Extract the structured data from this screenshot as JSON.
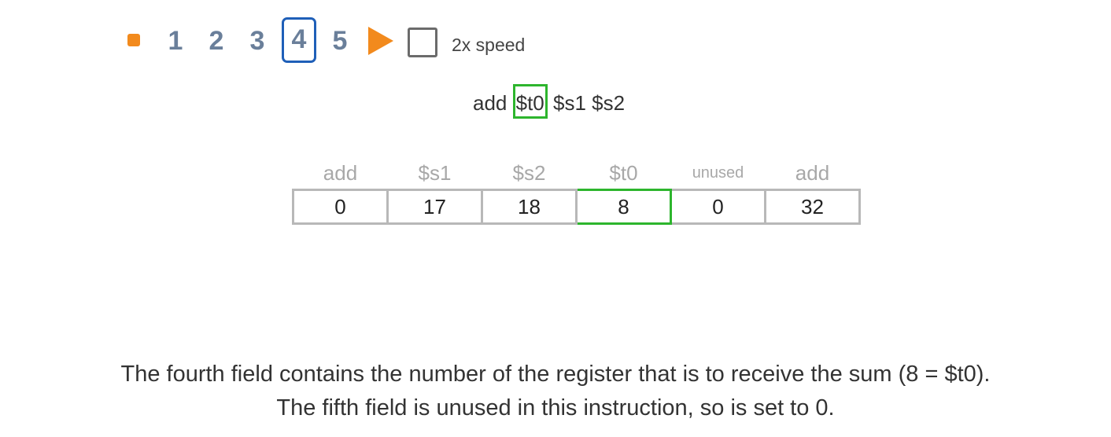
{
  "controls": {
    "steps": [
      "1",
      "2",
      "3",
      "4",
      "5"
    ],
    "active_step": "4",
    "speed_label": "2x speed",
    "speed_checked": false,
    "accent_color": "#f28a1d",
    "active_border_color": "#1f5fb8"
  },
  "instruction": {
    "op": "add",
    "rd": "$t0",
    "rs": "$s1",
    "rt": "$s2",
    "highlight_color": "#2db52d"
  },
  "fields": {
    "headers": [
      "add",
      "$s1",
      "$s2",
      "$t0",
      "unused",
      "add"
    ],
    "values": [
      "0",
      "17",
      "18",
      "8",
      "0",
      "32"
    ],
    "highlighted_index": 3
  },
  "caption": {
    "line1": "The fourth field contains the number of the register that is to receive the sum (8 = $t0).",
    "line2": "The fifth field is unused in this instruction, so is set to 0."
  }
}
